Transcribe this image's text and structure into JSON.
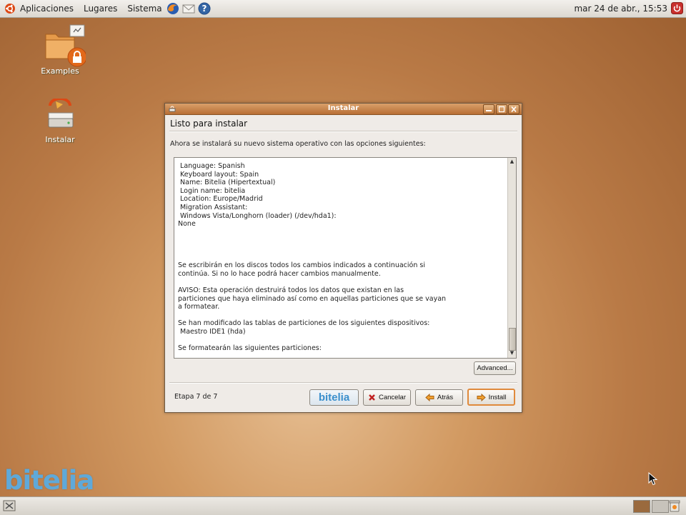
{
  "top_panel": {
    "menus": [
      "Aplicaciones",
      "Lugares",
      "Sistema"
    ],
    "launchers": [
      "firefox-icon",
      "mail-icon",
      "help-icon"
    ],
    "clock": "mar 24 de abr., 15:53"
  },
  "desktop": {
    "icons": [
      {
        "label": "Examples",
        "icon": "folder-locked-icon"
      },
      {
        "label": "Instalar",
        "icon": "installer-drive-icon"
      }
    ],
    "brand": "bitelia"
  },
  "window": {
    "title": "Instalar",
    "heading": "Listo para instalar",
    "intro": "Ahora se instalará su nuevo sistema operativo con las opciones siguientes:",
    "summary_lines": [
      " Language: Spanish",
      " Keyboard layout: Spain",
      " Name: Bitelia (Hipertextual)",
      " Login name: bitelia",
      " Location: Europe/Madrid",
      " Migration Assistant:",
      " Windows Vista/Longhorn (loader) (/dev/hda1):",
      "None",
      "",
      "",
      "",
      "",
      "Se escribirán en los discos todos los cambios indicados a continuación si",
      "continúa. Si no lo hace podrá hacer cambios manualmente.",
      "",
      "AVISO: Esta operación destruirá todos los datos que existan en las",
      "particiones que haya eliminado así como en aquellas particiones que se vayan",
      "a formatear.",
      "",
      "Se han modificado las tablas de particiones de los siguientes dispositivos:",
      " Maestro IDE1 (hda)",
      "",
      "Se formatearán las siguientes particiones:"
    ],
    "advanced_label": "Advanced...",
    "step_label": "Etapa 7 de 7",
    "brand_button": "bitelia",
    "cancel_label": "Cancelar",
    "back_label": "Atrás",
    "install_label": "Install"
  },
  "colors": {
    "accent": "#e08a3c",
    "titlebar": "#c47d40",
    "brand": "#3b8fcc"
  }
}
